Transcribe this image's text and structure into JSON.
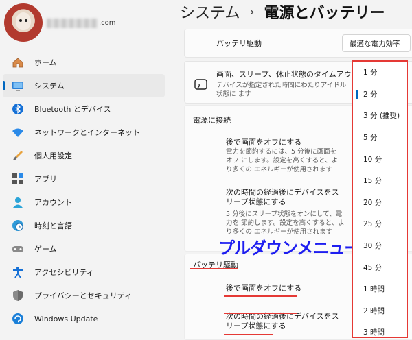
{
  "user": {
    "email_suffix": ".com"
  },
  "sidebar": {
    "items": [
      {
        "label": "ホーム",
        "icon": "home-icon"
      },
      {
        "label": "システム",
        "icon": "monitor-icon"
      },
      {
        "label": "Bluetooth とデバイス",
        "icon": "bluetooth-icon"
      },
      {
        "label": "ネットワークとインターネット",
        "icon": "wifi-icon"
      },
      {
        "label": "個人用設定",
        "icon": "brush-icon"
      },
      {
        "label": "アプリ",
        "icon": "apps-icon"
      },
      {
        "label": "アカウント",
        "icon": "account-icon"
      },
      {
        "label": "時刻と言語",
        "icon": "clock-globe-icon"
      },
      {
        "label": "ゲーム",
        "icon": "gamepad-icon"
      },
      {
        "label": "アクセシビリティ",
        "icon": "accessibility-icon"
      },
      {
        "label": "プライバシーとセキュリティ",
        "icon": "shield-icon"
      },
      {
        "label": "Windows Update",
        "icon": "update-icon"
      }
    ]
  },
  "header": {
    "parent": "システム",
    "current": "電源とバッテリー",
    "separator": "›"
  },
  "battery_mode": {
    "label": "バッテリ駆動",
    "value": "最適な電力効率"
  },
  "sleep_section": {
    "title": "画面、スリープ、休止状態のタイムアウト",
    "desc": "デバイスが指定された時間にわたりアイドル状態に ます"
  },
  "plugged_in": {
    "heading": "電源に接続",
    "screen_off_title": "後で画面をオフにする",
    "screen_off_desc": "電力を節約するには、5 分後に画面をオフ にします。設定を高くすると、より多くの エネルギーが使用されます",
    "sleep_title": "次の時間の経過後にデバイスをス リープ状態にする",
    "sleep_desc": "5 分後にスリープ状態をオンにして、電力を 節約します。設定を高くすると、より多くの エネルギーが使用されます"
  },
  "on_battery": {
    "heading": "バッテリ駆動",
    "screen_off_title": "後で画面をオフにする",
    "sleep_title": "次の時間の経過後にデバイスをス リープ状態にする"
  },
  "dropdown": {
    "selected_index": 1,
    "options": [
      "1 分",
      "2 分",
      "3 分 (推奨)",
      "5 分",
      "10 分",
      "15 分",
      "20 分",
      "25 分",
      "30 分",
      "45 分",
      "1 時間",
      "2 時間",
      "3 時間"
    ]
  },
  "annotation": {
    "text": "プルダウンメニュー"
  },
  "colors": {
    "accent": "#0067c0",
    "highlight_red": "#e53935",
    "annotation_blue": "#1e1ef0"
  }
}
